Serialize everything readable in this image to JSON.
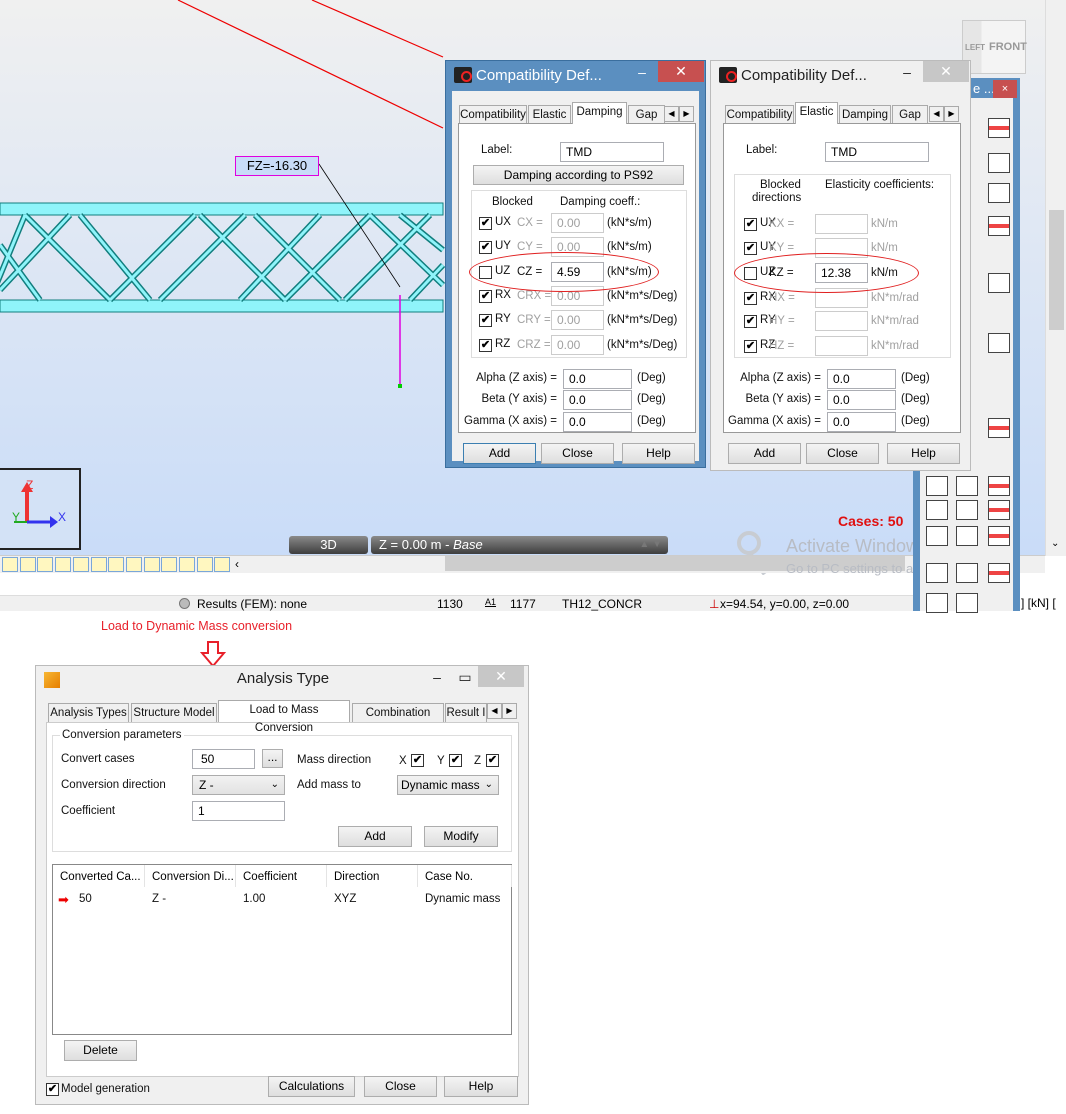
{
  "viewport": {
    "load_label": "FZ=-16.30",
    "axis_z": "Z",
    "axis_y": "Y",
    "axis_x": "X",
    "view_mode": "3D",
    "level": "Z = 0.00 m - ",
    "level_name": "Base",
    "cases": "Cases: 50",
    "view_cube": {
      "left": "LEFT",
      "front": "FRONT"
    },
    "watermark_title": "Activate Windows",
    "watermark_sub": "Go to PC settings to activate Windows."
  },
  "status_bar": {
    "results": "Results (FEM): none",
    "nodes": "1130",
    "bars_icon": "A1",
    "bars": "1177",
    "section": "TH12_CONCR",
    "coords": "x=94.54, y=0.00, z=0.00",
    "units": "] [kN] ["
  },
  "right_panel": {
    "title": "e ...",
    "close": "×"
  },
  "damping_dialog": {
    "title": "Compatibility Def...",
    "tabs": [
      "Compatibility",
      "Elastic",
      "Damping",
      "Gap"
    ],
    "active_tab": "Damping",
    "label_caption": "Label:",
    "label_value": "TMD",
    "ps92_button": "Damping according to PS92",
    "col_blocked": "Blocked",
    "col_coeff": "Damping coeff.:",
    "rows": [
      {
        "dof": "UX",
        "coef": "CX =",
        "value": "0.00",
        "unit": "(kN*s/m)",
        "checked": true
      },
      {
        "dof": "UY",
        "coef": "CY =",
        "value": "0.00",
        "unit": "(kN*s/m)",
        "checked": true
      },
      {
        "dof": "UZ",
        "coef": "CZ =",
        "value": "4.59",
        "unit": "(kN*s/m)",
        "checked": false
      },
      {
        "dof": "RX",
        "coef": "CRX =",
        "value": "0.00",
        "unit": "(kN*m*s/Deg)",
        "checked": true
      },
      {
        "dof": "RY",
        "coef": "CRY =",
        "value": "0.00",
        "unit": "(kN*m*s/Deg)",
        "checked": true
      },
      {
        "dof": "RZ",
        "coef": "CRZ =",
        "value": "0.00",
        "unit": "(kN*m*s/Deg)",
        "checked": true
      }
    ],
    "angles": [
      {
        "label": "Alpha (Z axis) =",
        "value": "0.0",
        "unit": "(Deg)"
      },
      {
        "label": "Beta (Y axis) =",
        "value": "0.0",
        "unit": "(Deg)"
      },
      {
        "label": "Gamma (X axis) =",
        "value": "0.0",
        "unit": "(Deg)"
      }
    ],
    "buttons": [
      "Add",
      "Close",
      "Help"
    ]
  },
  "elastic_dialog": {
    "title": "Compatibility Def...",
    "tabs": [
      "Compatibility",
      "Elastic",
      "Damping",
      "Gap"
    ],
    "active_tab": "Elastic",
    "label_caption": "Label:",
    "label_value": "TMD",
    "col_blocked_1": "Blocked",
    "col_blocked_2": "directions",
    "col_coeff": "Elasticity coefficients:",
    "rows": [
      {
        "dof": "UX",
        "coef": "KX =",
        "value": "",
        "unit": "kN/m",
        "checked": true
      },
      {
        "dof": "UY",
        "coef": "KY =",
        "value": "",
        "unit": "kN/m",
        "checked": true
      },
      {
        "dof": "UZ",
        "coef": "KZ =",
        "value": "12.38",
        "unit": "kN/m",
        "checked": false
      },
      {
        "dof": "RX",
        "coef": "HX =",
        "value": "",
        "unit": "kN*m/rad",
        "checked": true
      },
      {
        "dof": "RY",
        "coef": "HY =",
        "value": "",
        "unit": "kN*m/rad",
        "checked": true
      },
      {
        "dof": "RZ",
        "coef": "HZ =",
        "value": "",
        "unit": "kN*m/rad",
        "checked": true
      }
    ],
    "angles": [
      {
        "label": "Alpha (Z axis) =",
        "value": "0.0",
        "unit": "(Deg)"
      },
      {
        "label": "Beta (Y axis) =",
        "value": "0.0",
        "unit": "(Deg)"
      },
      {
        "label": "Gamma (X axis) =",
        "value": "0.0",
        "unit": "(Deg)"
      }
    ],
    "buttons": [
      "Add",
      "Close",
      "Help"
    ]
  },
  "annotation": {
    "text": "Load to Dynamic Mass conversion",
    "color": "#e8202a"
  },
  "analysis_dialog": {
    "title": "Analysis Type",
    "tabs": [
      "Analysis Types",
      "Structure Model",
      "Load to Mass Conversion",
      "Combination Sign",
      "Result I"
    ],
    "active_tab": "Load to Mass Conversion",
    "group_title": "Conversion parameters",
    "convert_cases_label": "Convert cases",
    "convert_cases_value": "50",
    "browse_button": "...",
    "mass_direction_label": "Mass direction",
    "mass_dirs": [
      {
        "axis": "X",
        "checked": true
      },
      {
        "axis": "Y",
        "checked": true
      },
      {
        "axis": "Z",
        "checked": true
      }
    ],
    "conversion_direction_label": "Conversion direction",
    "conversion_direction_value": "Z -",
    "add_mass_to_label": "Add mass to",
    "add_mass_to_value": "Dynamic mass",
    "coefficient_label": "Coefficient",
    "coefficient_value": "1",
    "add_button": "Add",
    "modify_button": "Modify",
    "table": {
      "columns": [
        "Converted Ca...",
        "Conversion Di...",
        "Coefficient",
        "Direction",
        "Case No."
      ],
      "rows": [
        [
          "50",
          "Z -",
          "1.00",
          "XYZ",
          "Dynamic mass"
        ]
      ]
    },
    "delete_button": "Delete",
    "model_generation_label": "Model generation",
    "model_generation_checked": true,
    "calculations_button": "Calculations",
    "close_button": "Close",
    "help_button": "Help"
  }
}
